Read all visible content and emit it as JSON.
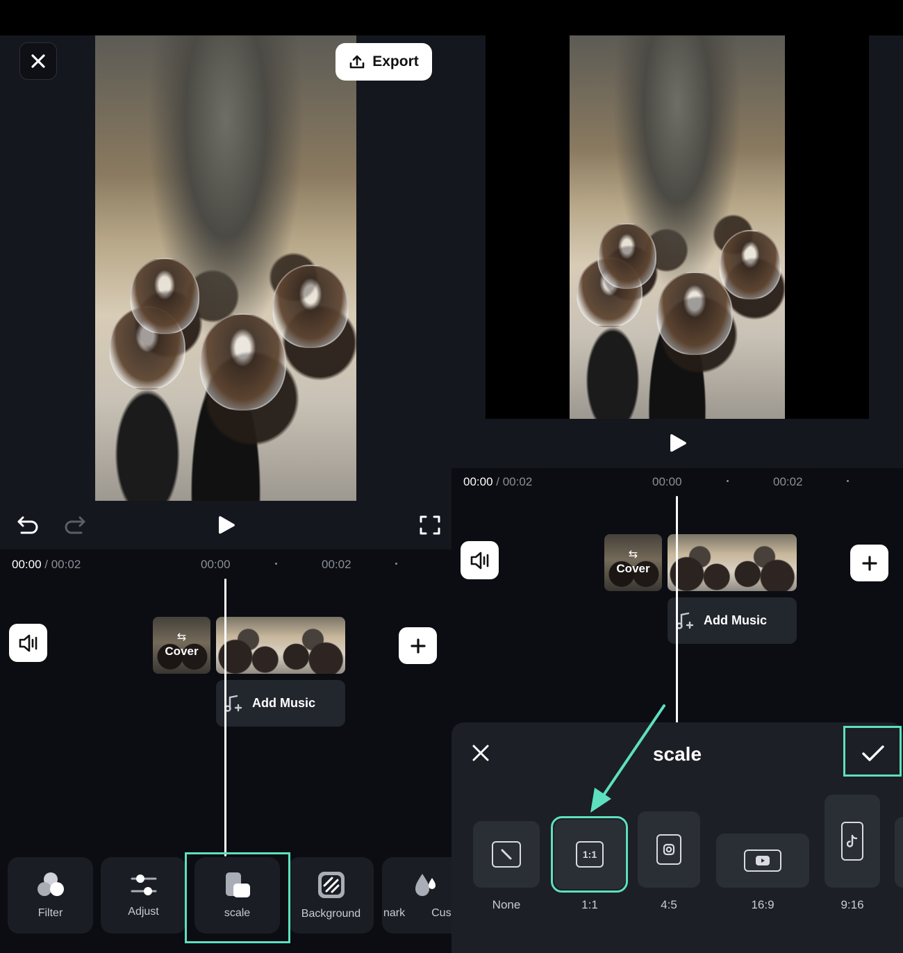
{
  "left": {
    "export_label": "Export",
    "time_current": "00:00",
    "time_total": "/ 00:02",
    "ruler": [
      "00:00",
      "00:02"
    ],
    "cover_label": "Cover",
    "add_music_label": "Add Music",
    "tools": [
      {
        "label": "Filter",
        "icon": "filter-icon"
      },
      {
        "label": "Adjust",
        "icon": "adjust-icon"
      },
      {
        "label": "scale",
        "icon": "scale-icon"
      },
      {
        "label": "Background",
        "icon": "background-icon"
      },
      {
        "label": "nark",
        "icon": "watermark-icon"
      },
      {
        "label": "Cus",
        "icon": "custom-icon"
      }
    ]
  },
  "right": {
    "time_current": "00:00",
    "time_total": "/ 00:02",
    "ruler": [
      "00:00",
      "00:02"
    ],
    "cover_label": "Cover",
    "add_music_label": "Add Music",
    "sheet_title": "scale",
    "ratios": [
      {
        "label": "None",
        "icon": "none-icon"
      },
      {
        "label": "1:1",
        "icon": "square-ratio-icon",
        "selected": true
      },
      {
        "label": "4:5",
        "icon": "instagram-icon"
      },
      {
        "label": "16:9",
        "icon": "youtube-icon"
      },
      {
        "label": "9:16",
        "icon": "tiktok-icon"
      }
    ]
  },
  "colors": {
    "accent": "#5ee0c0",
    "background": "#0b0d12",
    "panel": "#1a1d23"
  }
}
